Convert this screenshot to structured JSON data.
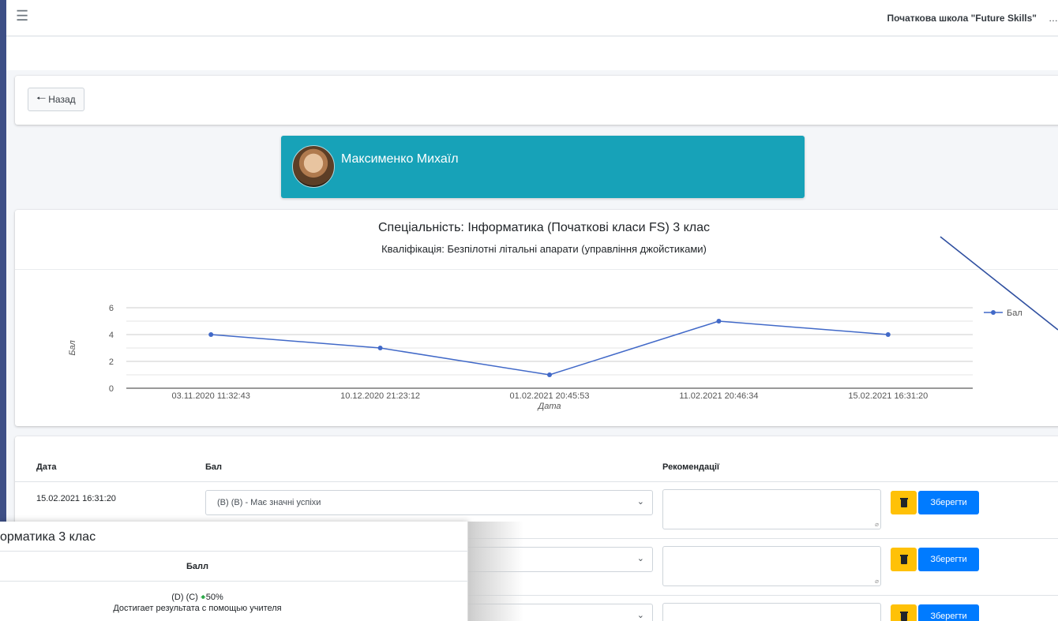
{
  "topbar": {
    "menu_icon": "hamburger-icon",
    "school_name": "Початкова школа \"Future Skills\"",
    "cut_glyph": "…"
  },
  "back_button": {
    "label": "Назад",
    "icon": "arrow-left-icon"
  },
  "student": {
    "name": "Максименко Михаїл",
    "avatar_icon": "student-photo"
  },
  "specialty": "Спеціальність: Інформатика (Початкові класи FS) 3 клас",
  "qualification": "Кваліфікація: Безпілотні літальні апарати (управління джойстиками)",
  "chart_data": {
    "type": "line",
    "categories": [
      "03.11.2020 11:32:43",
      "10.12.2020 21:23:12",
      "01.02.2021 20:45:53",
      "11.02.2021 20:46:34",
      "15.02.2021 16:31:20"
    ],
    "series": [
      {
        "name": "Бал",
        "values": [
          4,
          3,
          1,
          5,
          4
        ],
        "color": "#4169c8"
      }
    ],
    "xlabel": "Дата",
    "ylabel": "Бал",
    "ylim": [
      0,
      6
    ],
    "yticks": [
      0,
      2,
      4,
      6
    ],
    "grid": true,
    "legend": "right"
  },
  "table": {
    "headers": {
      "date": "Дата",
      "score": "Бал",
      "recommendations": "Рекомендації"
    },
    "rows": [
      {
        "date": "15.02.2021 16:31:20",
        "score": "(B) (B) - Має значні успіхи",
        "save_label": "Зберегти"
      },
      {
        "date": "",
        "score": "",
        "save_label": "Зберегти"
      },
      {
        "date": "",
        "score": "",
        "save_label": "Зберегти"
      }
    ]
  },
  "popup": {
    "title": "орматика 3 клас",
    "header": "Балл",
    "grade": "(D) (C)",
    "percent": "50%",
    "description": "Достигает результата с помощью учителя"
  },
  "colors": {
    "accent": "#17a2b8",
    "primary": "#007bff",
    "warning": "#ffc107",
    "line": "#4169c8"
  }
}
